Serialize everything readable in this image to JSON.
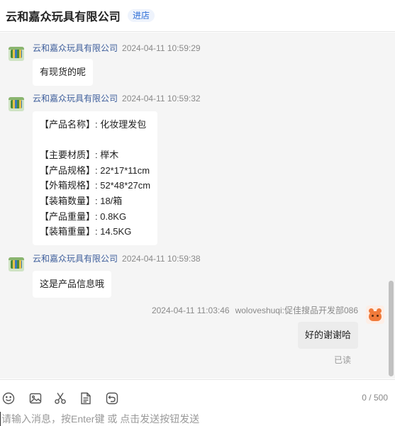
{
  "header": {
    "shop_name": "云和嘉众玩具有限公司",
    "enter_label": "进店"
  },
  "messages": [
    {
      "sender": "云和嘉众玩具有限公司",
      "time": "2024-04-11 10:59:29",
      "text": "有现货的呢"
    },
    {
      "sender": "云和嘉众玩具有限公司",
      "time": "2024-04-11 10:59:32",
      "text": "【产品名称】: 化妆理发包\n\n【主要材质】: 榉木\n【产品规格】: 22*17*11cm\n【外箱规格】: 52*48*27cm\n【装箱数量】: 18/箱\n【产品重量】: 0.8KG\n【装箱重量】: 14.5KG"
    },
    {
      "sender": "云和嘉众玩具有限公司",
      "time": "2024-04-11 10:59:38",
      "text": "这是产品信息哦"
    },
    {
      "sender": "woloveshuqi:促佳搜品开发部086",
      "time": "2024-04-11 11:03:46",
      "text": "好的谢谢哈",
      "status": "已读"
    }
  ],
  "toolbar": {
    "icons": [
      "emoji-icon",
      "image-icon",
      "scissors-icon",
      "document-icon",
      "history-icon"
    ],
    "counter": "0 / 500"
  },
  "input": {
    "placeholder": "请输入消息，按Enter键 或 点击发送按钮发送",
    "value": ""
  },
  "colors": {
    "accent": "#2b6cd6",
    "sender_name": "#3f5f9c",
    "chat_bg": "#f5f5f5"
  }
}
